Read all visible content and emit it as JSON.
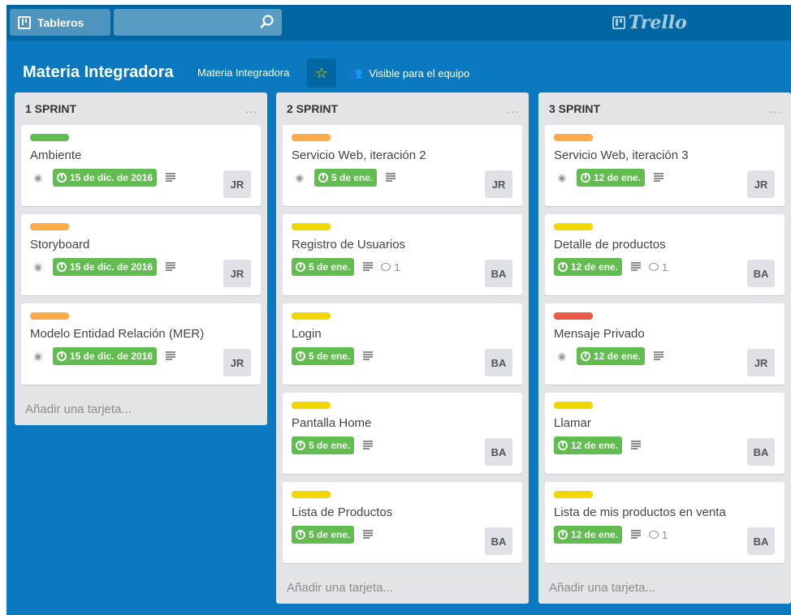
{
  "header": {
    "boards_label": "Tableros",
    "search_placeholder": "",
    "logo_text": "Trello"
  },
  "board": {
    "title": "Materia Integradora",
    "org": "Materia Integradora",
    "visibility": "Visible para el equipo"
  },
  "colors": {
    "green": "#61bd4f",
    "orange": "#ffab4a",
    "yellow": "#f2d600",
    "red": "#eb5a46"
  },
  "lists": [
    {
      "title": "1 SPRINT",
      "menu": "...",
      "add_card": "Añadir una tarjeta...",
      "cards": [
        {
          "label_color": "#61bd4f",
          "title": "Ambiente",
          "watched": true,
          "due": "15 de dic. de 2016",
          "desc": true,
          "comments": "",
          "member": "JR"
        },
        {
          "label_color": "#ffab4a",
          "title": "Storyboard",
          "watched": true,
          "due": "15 de dic. de 2016",
          "desc": true,
          "comments": "",
          "member": "JR"
        },
        {
          "label_color": "#ffab4a",
          "title": "Modelo Entidad Relación (MER)",
          "watched": true,
          "due": "15 de dic. de 2016",
          "desc": true,
          "comments": "",
          "member": "JR"
        }
      ]
    },
    {
      "title": "2 SPRINT",
      "menu": "...",
      "add_card": "Añadir una tarjeta...",
      "cards": [
        {
          "label_color": "#ffab4a",
          "title": "Servicio Web, iteración 2",
          "watched": true,
          "due": "5 de ene.",
          "desc": true,
          "comments": "",
          "member": "JR"
        },
        {
          "label_color": "#f2d600",
          "title": "Registro de Usuarios",
          "watched": false,
          "due": "5 de ene.",
          "desc": true,
          "comments": "1",
          "member": "BA"
        },
        {
          "label_color": "#f2d600",
          "title": "Login",
          "watched": false,
          "due": "5 de ene.",
          "desc": true,
          "comments": "",
          "member": "BA"
        },
        {
          "label_color": "#f2d600",
          "title": "Pantalla Home",
          "watched": false,
          "due": "5 de ene.",
          "desc": true,
          "comments": "",
          "member": "BA"
        },
        {
          "label_color": "#f2d600",
          "title": "Lista de Productos",
          "watched": false,
          "due": "5 de ene.",
          "desc": true,
          "comments": "",
          "member": "BA"
        }
      ]
    },
    {
      "title": "3 SPRINT",
      "menu": "...",
      "add_card": "Añadir una tarjeta...",
      "cards": [
        {
          "label_color": "#ffab4a",
          "title": "Servicio Web, iteración 3",
          "watched": true,
          "due": "12 de ene.",
          "desc": true,
          "comments": "",
          "member": "JR"
        },
        {
          "label_color": "#f2d600",
          "title": "Detalle de productos",
          "watched": false,
          "due": "12 de ene.",
          "desc": true,
          "comments": "1",
          "member": "BA"
        },
        {
          "label_color": "#eb5a46",
          "title": "Mensaje Privado",
          "watched": true,
          "due": "12 de ene.",
          "desc": true,
          "comments": "",
          "member": "JR"
        },
        {
          "label_color": "#f2d600",
          "title": "Llamar",
          "watched": false,
          "due": "12 de ene.",
          "desc": true,
          "comments": "",
          "member": "BA"
        },
        {
          "label_color": "#f2d600",
          "title": "Lista de mis productos en venta",
          "watched": false,
          "due": "12 de ene.",
          "desc": true,
          "comments": "1",
          "member": "BA"
        }
      ]
    }
  ]
}
